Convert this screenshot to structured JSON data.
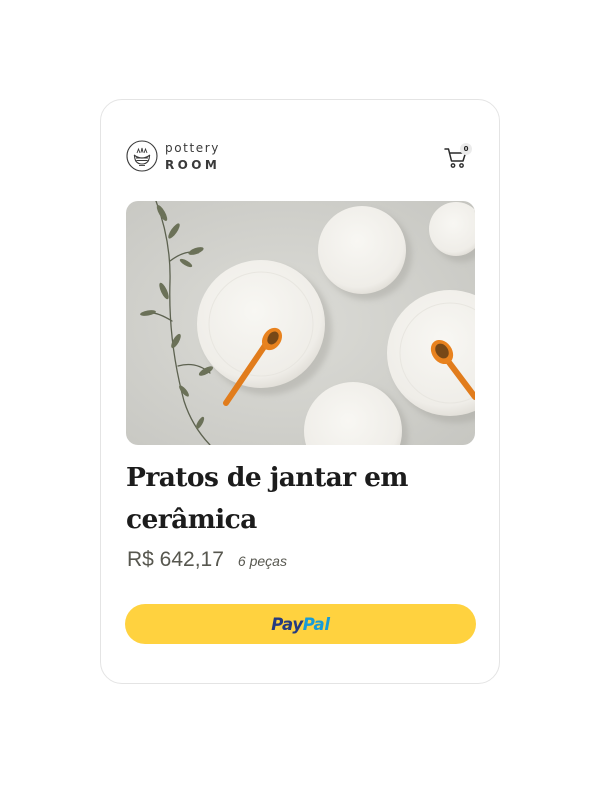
{
  "brand": {
    "line1": "pottery",
    "line2": "ROOM",
    "logo_icon": "bowl-logo-icon"
  },
  "cart": {
    "icon": "cart-icon",
    "count": "0"
  },
  "product": {
    "image": "ceramic-plates-photo",
    "title": "Pratos de jantar em cerâmica",
    "price": "R$ 642,17",
    "quantity": "6 peças"
  },
  "checkout": {
    "paypal_pay": "Pay",
    "paypal_pal": "Pal"
  },
  "colors": {
    "button_bg": "#ffd23f",
    "paypal_dark_blue": "#253b80",
    "paypal_light_blue": "#179bd7",
    "spoon_orange": "#e8821e",
    "text_dark": "#1c1c1c",
    "text_muted": "#57574f"
  }
}
